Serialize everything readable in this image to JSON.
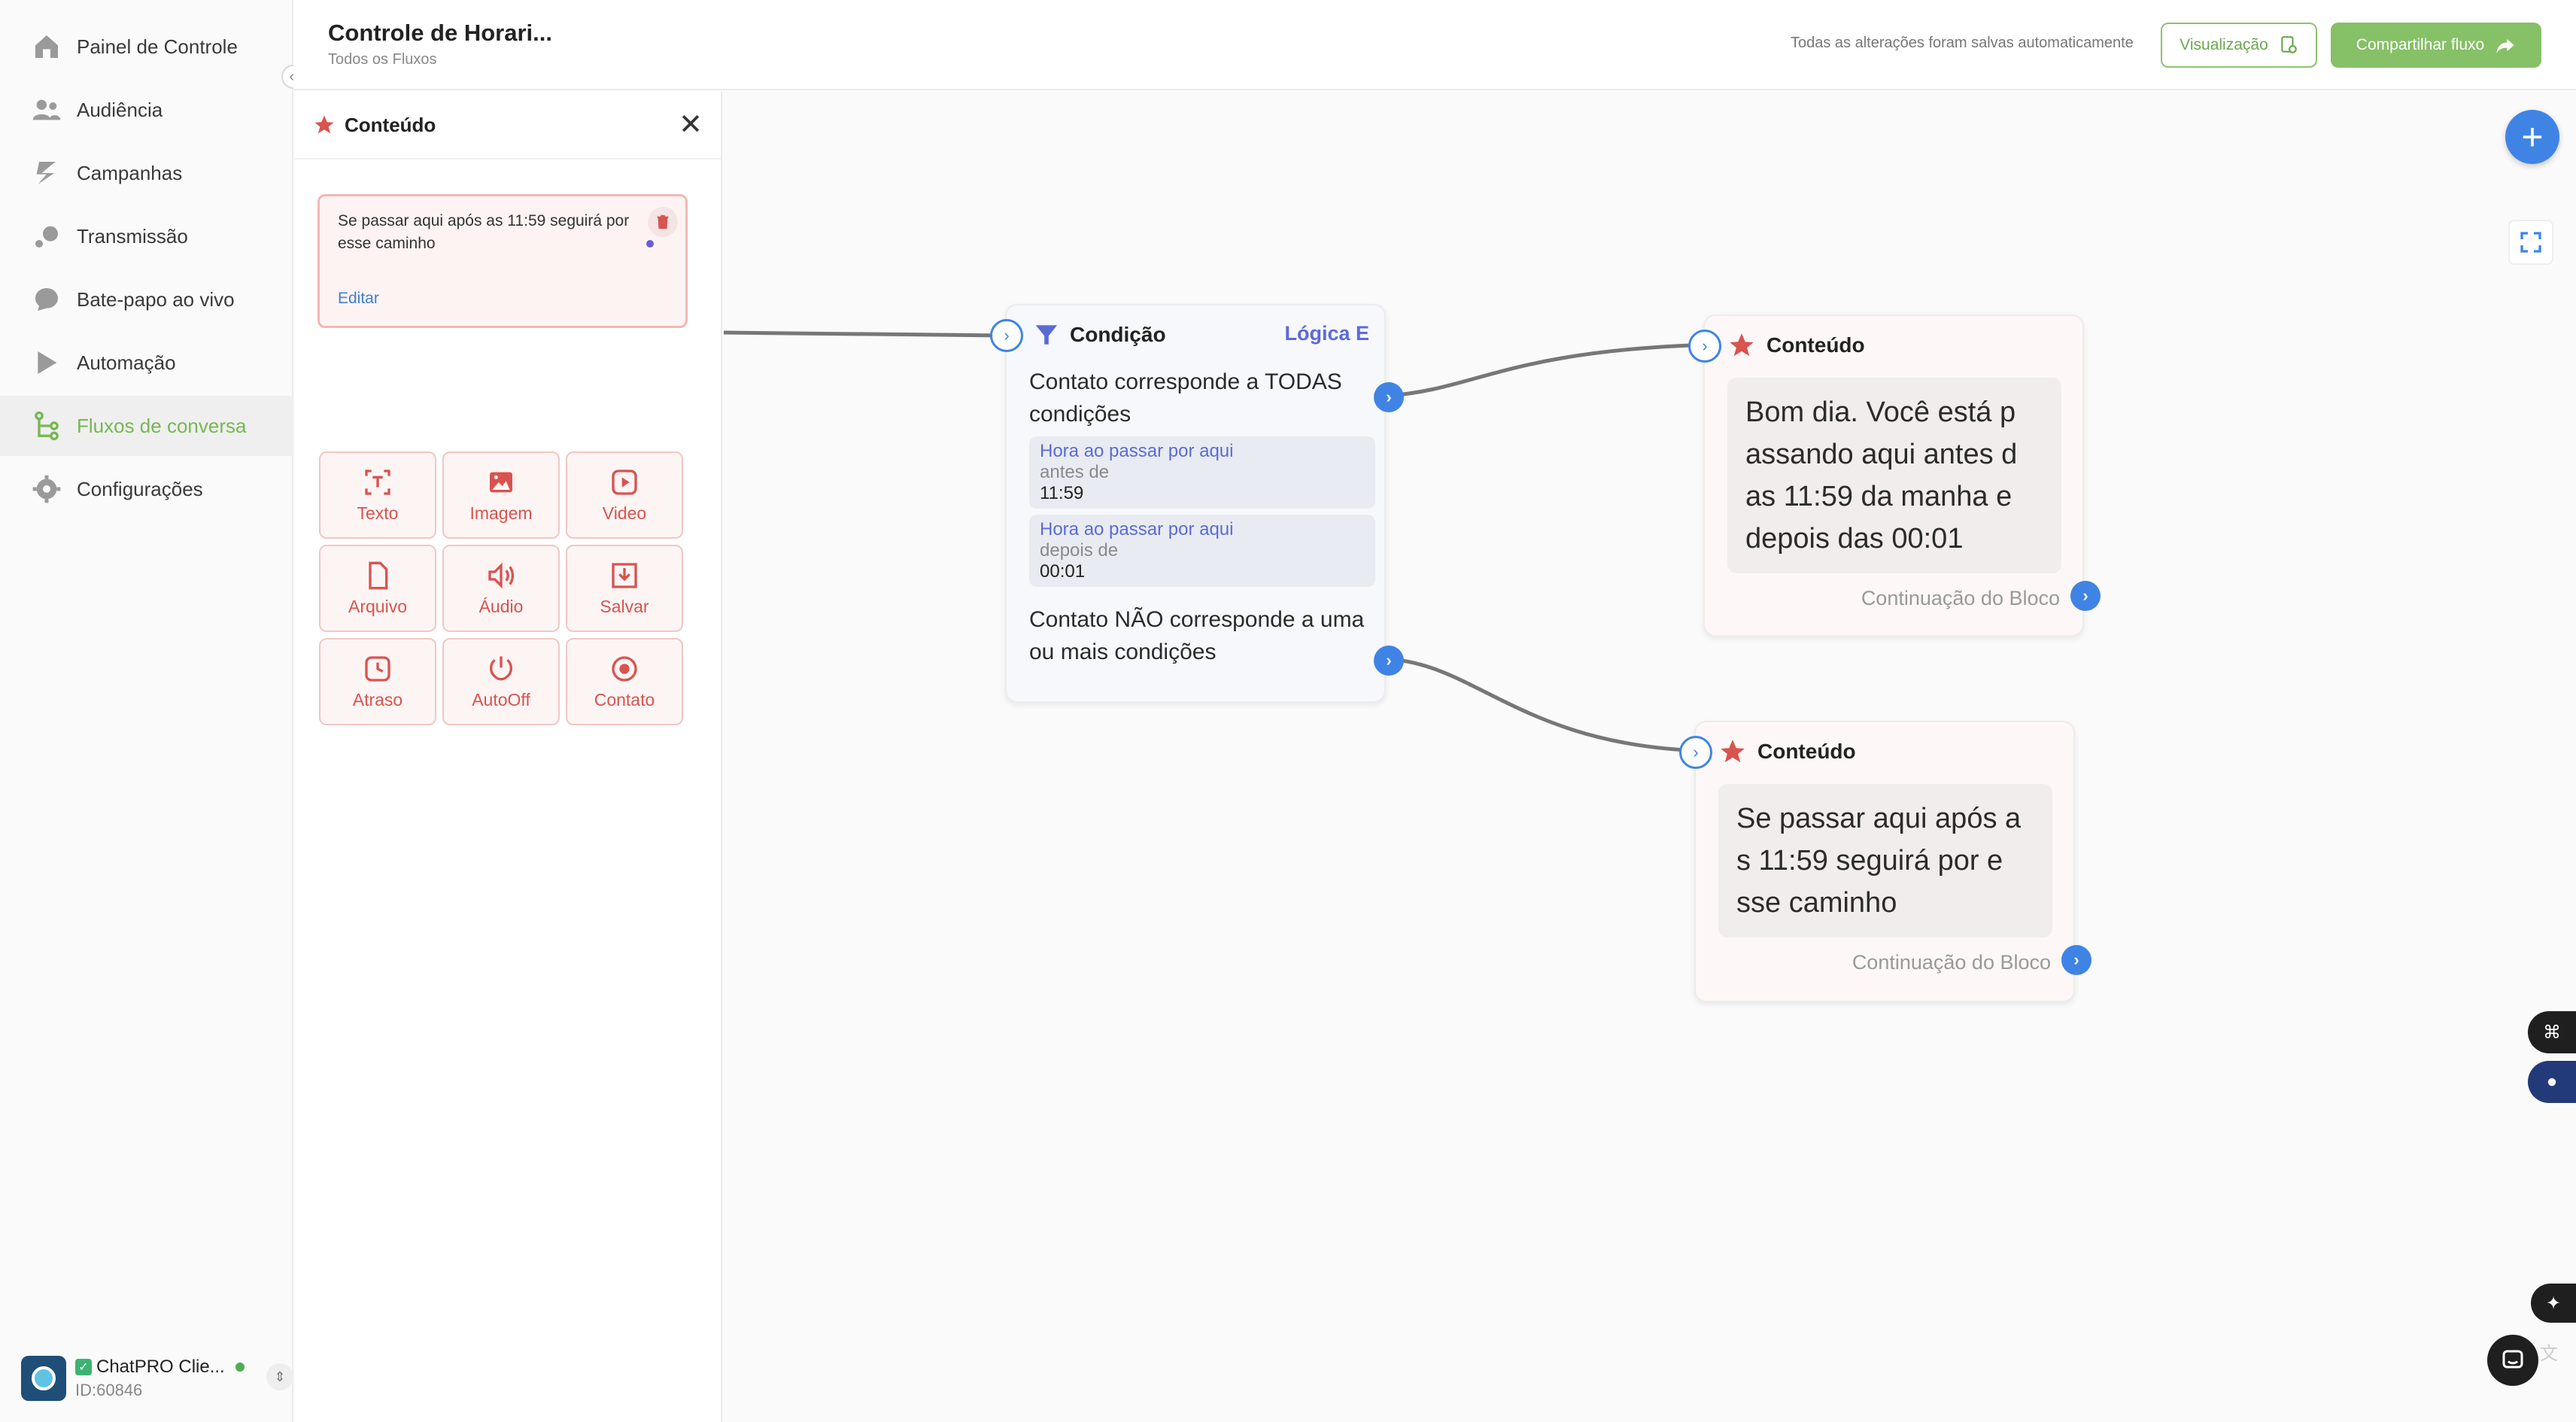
{
  "nav": {
    "items": [
      {
        "label": "Painel de Controle",
        "icon": "home-icon"
      },
      {
        "label": "Audiência",
        "icon": "users-icon"
      },
      {
        "label": "Campanhas",
        "icon": "campaign-icon"
      },
      {
        "label": "Transmissão",
        "icon": "broadcast-icon"
      },
      {
        "label": "Bate-papo ao vivo",
        "icon": "chat-icon"
      },
      {
        "label": "Automação",
        "icon": "automation-icon"
      },
      {
        "label": "Fluxos de conversa",
        "icon": "flow-icon"
      },
      {
        "label": "Configurações",
        "icon": "gear-icon"
      }
    ],
    "active_index": 6
  },
  "account": {
    "name": "ChatPRO Clie...",
    "id": "ID:60846"
  },
  "header": {
    "title": "Controle de Horari...",
    "breadcrumb": "Todos os Fluxos",
    "save_status": "Todas as alterações foram salvas automaticamente",
    "preview_label": "Visualização",
    "share_label": "Compartilhar fluxo"
  },
  "panel": {
    "title": "Conteúdo",
    "message_text": "Se passar aqui após as 11:59 seguirá por esse caminho",
    "edit_label": "Editar",
    "tools": [
      {
        "label": "Texto",
        "icon": "text-icon"
      },
      {
        "label": "Imagem",
        "icon": "image-icon"
      },
      {
        "label": "Video",
        "icon": "video-icon"
      },
      {
        "label": "Arquivo",
        "icon": "file-icon"
      },
      {
        "label": "Áudio",
        "icon": "audio-icon"
      },
      {
        "label": "Salvar",
        "icon": "save-icon"
      },
      {
        "label": "Atraso",
        "icon": "delay-icon"
      },
      {
        "label": "AutoOff",
        "icon": "power-icon"
      },
      {
        "label": "Contato",
        "icon": "contact-icon"
      }
    ]
  },
  "condition_node": {
    "title": "Condição",
    "logic": "Lógica E",
    "match_all": "Contato corresponde a TODAS condições",
    "conditions": [
      {
        "field": "Hora ao passar por aqui",
        "operator": "antes de",
        "value": "11:59"
      },
      {
        "field": "Hora ao passar por aqui",
        "operator": "depois de",
        "value": "00:01"
      }
    ],
    "match_none": "Contato NÃO corresponde a uma ou mais condições"
  },
  "content_nodes": [
    {
      "title": "Conteúdo",
      "message": "Bom dia. Você está p assando aqui antes d as 11:59 da manha e depois das 00:01",
      "continuation": "Continuação do Bloco"
    },
    {
      "title": "Conteúdo",
      "message": "Se passar aqui após a s 11:59 seguirá por e sse caminho",
      "continuation": "Continuação do Bloco"
    }
  ],
  "colors": {
    "accent_green": "#76b852",
    "port_blue": "#3f84e5",
    "content_red": "#d9534f",
    "logic_purple": "#5b6bd6"
  }
}
